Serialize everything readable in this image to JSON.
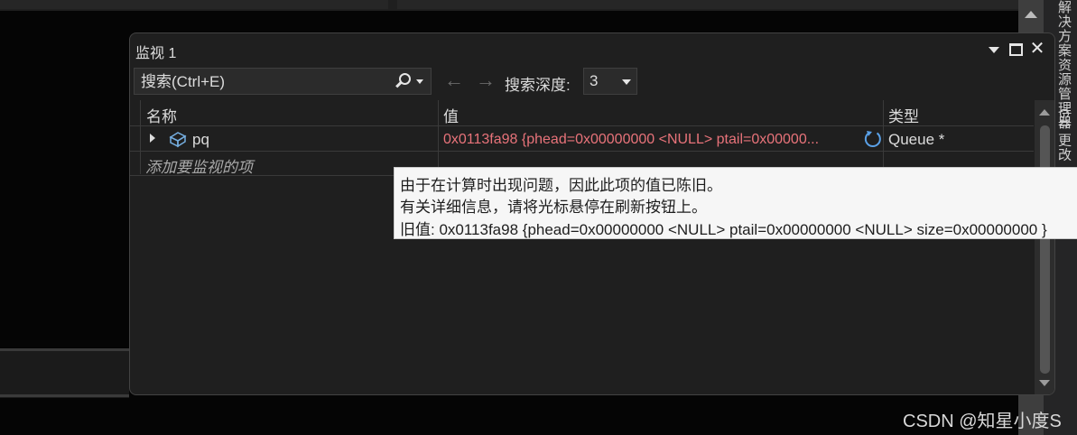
{
  "window": {
    "title": "监视 1"
  },
  "toolbar": {
    "search_placeholder": "搜索(Ctrl+E)",
    "back_arrow": "←",
    "forward_arrow": "→",
    "depth_label": "搜索深度:",
    "depth_value": "3"
  },
  "grid": {
    "columns": [
      "名称",
      "值",
      "类型"
    ],
    "rows": [
      {
        "name": "pq",
        "value": "0x0113fa98 {phead=0x00000000 <NULL> ptail=0x00000...",
        "type": "Queue *"
      }
    ],
    "add_watch_placeholder": "添加要监视的项"
  },
  "tooltip": {
    "line1": "由于在计算时出现问题，因此此项的值已陈旧。",
    "line2": "有关详细信息，请将光标悬停在刷新按钮上。",
    "line3": "旧值: 0x0113fa98 {phead=0x00000000 <NULL> ptail=0x00000000 <NULL> size=0x00000000 }"
  },
  "side_tabs": [
    "解决方案资源管理器",
    "Git 更改"
  ],
  "watermark": "CSDN @知星小度S",
  "colors": {
    "stale_value": "#e8737a",
    "window_bg": "#1f1f1f",
    "tooltip_bg": "#f6f6f6"
  }
}
